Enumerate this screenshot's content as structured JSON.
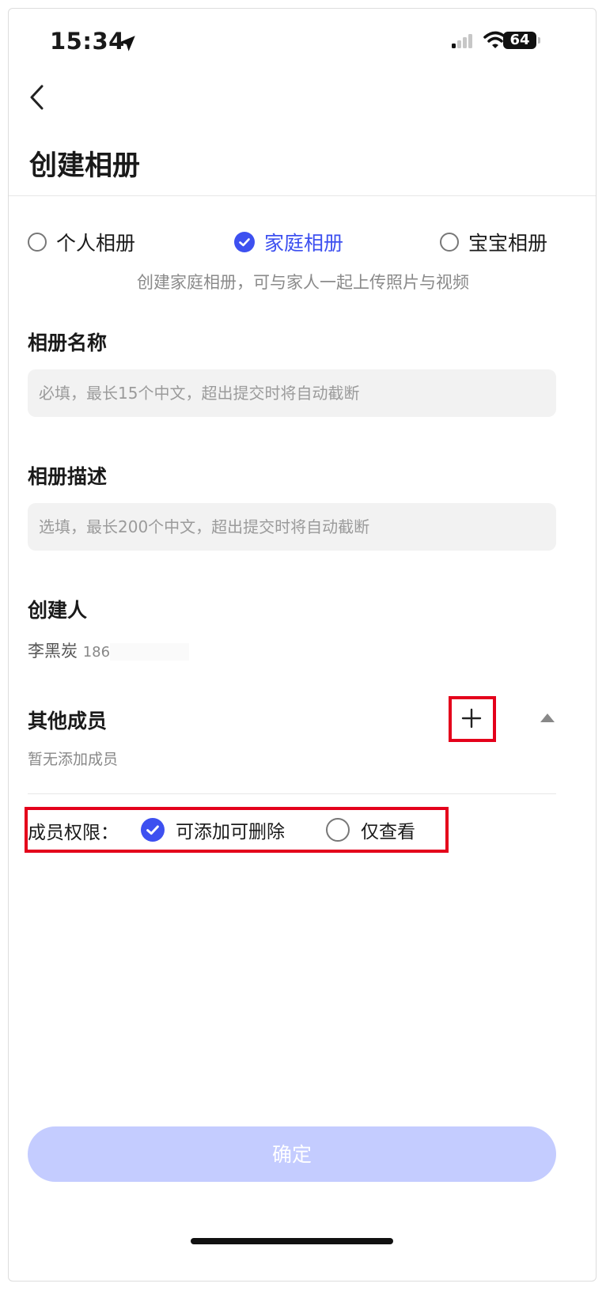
{
  "status_bar": {
    "time": "15:34",
    "battery": "64"
  },
  "header": {
    "title": "创建相册"
  },
  "album_types": [
    {
      "label": "个人相册",
      "selected": false
    },
    {
      "label": "家庭相册",
      "selected": true
    },
    {
      "label": "宝宝相册",
      "selected": false
    }
  ],
  "type_tip": "创建家庭相册，可与家人一起上传照片与视频",
  "name_field": {
    "label": "相册名称",
    "placeholder": "必填，最长15个中文，超出提交时将自动截断",
    "value": ""
  },
  "desc_field": {
    "label": "相册描述",
    "placeholder": "选填，最长200个中文，超出提交时将自动截断",
    "value": ""
  },
  "creator": {
    "label": "创建人",
    "name": "李黑炭",
    "phone_prefix": "186"
  },
  "members": {
    "label": "其他成员",
    "empty_hint": "暂无添加成员"
  },
  "permission": {
    "label": "成员权限：",
    "options": [
      {
        "label": "可添加可删除",
        "selected": true
      },
      {
        "label": "仅查看",
        "selected": false
      }
    ]
  },
  "confirm_button": "确定",
  "colors": {
    "accent": "#3d50f0",
    "highlight_box": "#e4001b",
    "button_disabled": "#c4ccff"
  }
}
